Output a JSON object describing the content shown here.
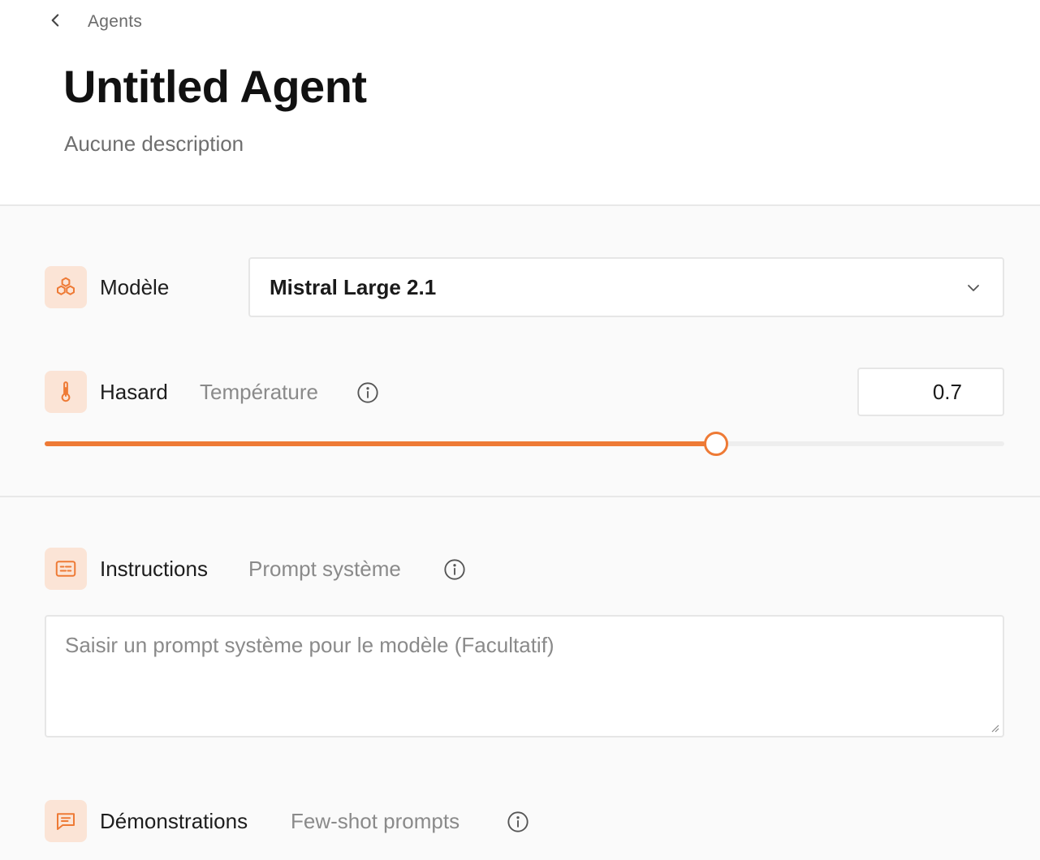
{
  "breadcrumb": {
    "back_label": "Agents"
  },
  "page": {
    "title": "Untitled Agent",
    "description": "Aucune description"
  },
  "model": {
    "label": "Modèle",
    "selected": "Mistral Large 2.1"
  },
  "randomness": {
    "label": "Hasard",
    "sublabel": "Température",
    "value": "0.7",
    "slider_fraction": 0.7
  },
  "instructions": {
    "label": "Instructions",
    "sublabel": "Prompt système",
    "placeholder": "Saisir un prompt système pour le modèle (Facultatif)"
  },
  "demonstrations": {
    "label": "Démonstrations",
    "sublabel": "Few-shot prompts"
  },
  "colors": {
    "accent": "#ee7a35",
    "icon_bg": "#fbe4d6"
  }
}
